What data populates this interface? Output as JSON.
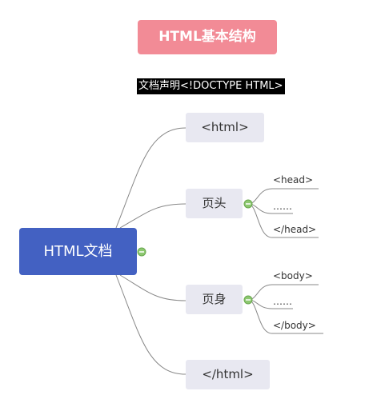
{
  "title": "HTML基本结构",
  "doctype": "文档声明<!DOCTYPE HTML>",
  "root": "HTML文档",
  "branches": {
    "html_open": "<html>",
    "head": "页头",
    "body": "页身",
    "html_close": "</html>"
  },
  "head_children": [
    "<head>",
    "……",
    "</head>"
  ],
  "body_children": [
    "<body>",
    "……",
    "</body>"
  ],
  "colors": {
    "title_bg": "#f28b96",
    "root_bg": "#4361c2",
    "node_bg": "#e8e8f1",
    "collapse_toggle": "#8dc870"
  }
}
